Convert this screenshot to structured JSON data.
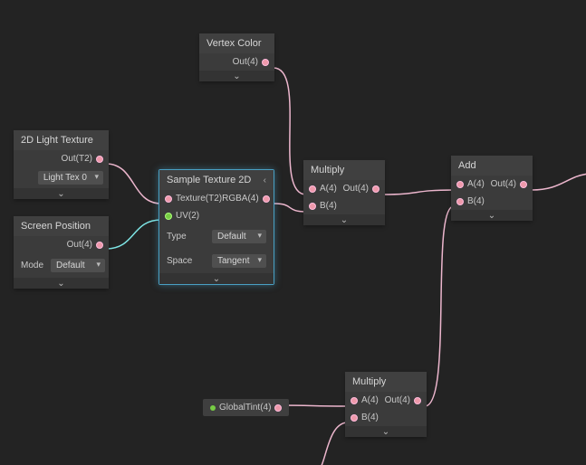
{
  "nodes": {
    "vertex_color": {
      "title": "Vertex Color",
      "out": "Out(4)"
    },
    "light_texture": {
      "title": "2D Light Texture",
      "out": "Out(T2)",
      "dropdown": "Light Tex 0"
    },
    "screen_position": {
      "title": "Screen Position",
      "out": "Out(4)",
      "mode_label": "Mode",
      "mode_value": "Default"
    },
    "sample_texture": {
      "title": "Sample Texture 2D",
      "in_texture": "Texture(T2)",
      "in_uv": "UV(2)",
      "out_rgba": "RGBA(4)",
      "type_label": "Type",
      "type_value": "Default",
      "space_label": "Space",
      "space_value": "Tangent"
    },
    "multiply1": {
      "title": "Multiply",
      "in_a": "A(4)",
      "in_b": "B(4)",
      "out": "Out(4)"
    },
    "add": {
      "title": "Add",
      "in_a": "A(4)",
      "in_b": "B(4)",
      "out": "Out(4)"
    },
    "globaltint": {
      "label": "GlobalTint(4)"
    },
    "multiply2": {
      "title": "Multiply",
      "in_a": "A(4)",
      "in_b": "B(4)",
      "out": "Out(4)"
    }
  }
}
